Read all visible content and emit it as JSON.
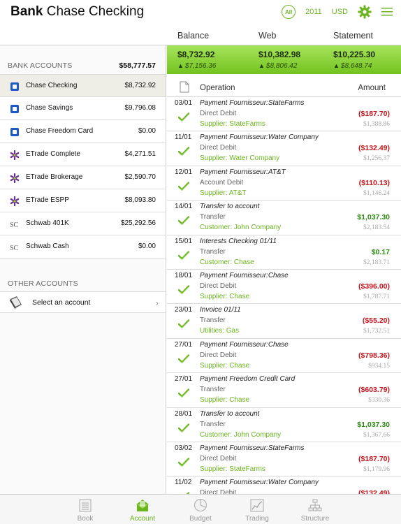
{
  "header": {
    "title_bold": "Bank",
    "title_rest": "Chase Checking",
    "all_label": "All",
    "year": "2011",
    "currency": "USD"
  },
  "columns": {
    "balance": "Balance",
    "web": "Web",
    "statement": "Statement"
  },
  "bank_accounts": {
    "heading": "BANK ACCOUNTS",
    "total": "$58,777.57",
    "items": [
      {
        "name": "Chase Checking",
        "amount": "$8,732.92",
        "icon": "chase-icon"
      },
      {
        "name": "Chase Savings",
        "amount": "$9,796.08",
        "icon": "chase-icon"
      },
      {
        "name": "Chase Freedom Card",
        "amount": "$0.00",
        "icon": "chase-icon"
      },
      {
        "name": "ETrade Complete",
        "amount": "$4,271.51",
        "icon": "etrade-icon"
      },
      {
        "name": "ETrade Brokerage",
        "amount": "$2,590.70",
        "icon": "etrade-icon"
      },
      {
        "name": "ETrade ESPP",
        "amount": "$8,093.80",
        "icon": "etrade-icon"
      },
      {
        "name": "Schwab 401K",
        "amount": "$25,292.56",
        "icon": "schwab-icon"
      },
      {
        "name": "Schwab Cash",
        "amount": "$0.00",
        "icon": "schwab-icon"
      }
    ]
  },
  "other_accounts": {
    "heading": "OTHER ACCOUNTS",
    "select_label": "Select an account"
  },
  "balances": {
    "balance": {
      "value": "$8,732.92",
      "sub": "$7,156.36"
    },
    "web": {
      "value": "$10,382.98",
      "sub": "$8,806.42"
    },
    "statement": {
      "value": "$10,225.30",
      "sub": "$8,648.74"
    }
  },
  "operations": {
    "header_operation": "Operation",
    "header_amount": "Amount",
    "rows": [
      {
        "date": "03/01",
        "title": "Payment Fournisseur:StateFarms",
        "type": "Direct Debit",
        "party": "Supplier: StateFarms",
        "amount": "($187.70)",
        "sign": "neg",
        "balance": "$1,388.86"
      },
      {
        "date": "11/01",
        "title": "Payment Fournisseur:Water Company",
        "type": "Direct Debit",
        "party": "Supplier: Water Company",
        "amount": "($132.49)",
        "sign": "neg",
        "balance": "$1,256.37"
      },
      {
        "date": "12/01",
        "title": "Payment Fournisseur:AT&T",
        "type": "Account Debit",
        "party": "Supplier: AT&T",
        "amount": "($110.13)",
        "sign": "neg",
        "balance": "$1,146.24"
      },
      {
        "date": "14/01",
        "title": "Transfer to account",
        "type": "Transfer",
        "party": "Customer: John Company",
        "amount": "$1,037.30",
        "sign": "pos",
        "balance": "$2,183.54"
      },
      {
        "date": "15/01",
        "title": "Interests Checking 01/11",
        "type": "Transfer",
        "party": "Customer: Chase",
        "amount": "$0.17",
        "sign": "pos",
        "balance": "$2,183.71"
      },
      {
        "date": "18/01",
        "title": "Payment Fournisseur:Chase",
        "type": "Direct Debit",
        "party": "Supplier: Chase",
        "amount": "($396.00)",
        "sign": "neg",
        "balance": "$1,787.71"
      },
      {
        "date": "23/01",
        "title": "Invoice 01/11",
        "type": "Transfer",
        "party": "Utilities: Gas",
        "amount": "($55.20)",
        "sign": "neg",
        "balance": "$1,732.51"
      },
      {
        "date": "27/01",
        "title": "Payment Fournisseur:Chase",
        "type": "Direct Debit",
        "party": "Supplier: Chase",
        "amount": "($798.36)",
        "sign": "neg",
        "balance": "$934.15"
      },
      {
        "date": "27/01",
        "title": "Payment Freedom Credit Card",
        "type": "Transfer",
        "party": "Supplier: Chase",
        "amount": "($603.79)",
        "sign": "neg",
        "balance": "$330.36"
      },
      {
        "date": "28/01",
        "title": "Transfer to account",
        "type": "Transfer",
        "party": "Customer: John Company",
        "amount": "$1,037.30",
        "sign": "pos",
        "balance": "$1,367.66"
      },
      {
        "date": "03/02",
        "title": "Payment Fournisseur:StateFarms",
        "type": "Direct Debit",
        "party": "Supplier: StateFarms",
        "amount": "($187.70)",
        "sign": "neg",
        "balance": "$1,179.96"
      },
      {
        "date": "11/02",
        "title": "Payment Fournisseur:Water Company",
        "type": "Direct Debit",
        "party": "",
        "amount": "($132.49)",
        "sign": "neg",
        "balance": ""
      }
    ]
  },
  "tabs": [
    {
      "label": "Book",
      "icon": "book-icon",
      "active": false
    },
    {
      "label": "Account",
      "icon": "account-icon",
      "active": true
    },
    {
      "label": "Budget",
      "icon": "pie-chart-icon",
      "active": false
    },
    {
      "label": "Trading",
      "icon": "line-chart-icon",
      "active": false
    },
    {
      "label": "Structure",
      "icon": "hierarchy-icon",
      "active": false
    }
  ],
  "colors": {
    "accent": "#6ab41e",
    "negative": "#c4151c",
    "positive": "#2d8a13",
    "chase_blue": "#1d5ac4",
    "etrade_purple": "#6a2d91"
  }
}
